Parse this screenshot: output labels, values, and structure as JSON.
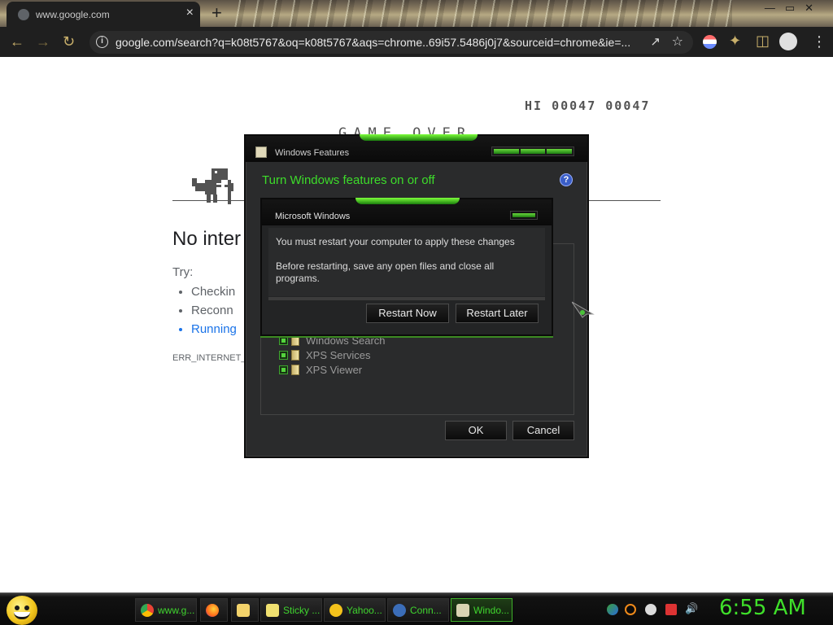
{
  "browser": {
    "tab_title": "www.google.com",
    "tab_close": "×",
    "new_tab": "+",
    "window_controls": "—▭✕",
    "url": "google.com/search?q=k08t5767&oq=k08t5767&aqs=chrome..69i57.5486j0j7&sourceid=chrome&ie=..."
  },
  "page": {
    "hi_score": "HI 00047 00047",
    "game_over": "GAME OVER",
    "heading": "No inter",
    "try_label": "Try:",
    "suggestions": [
      "Checkin",
      "Reconn",
      "Running"
    ],
    "error_code": "ERR_INTERNET_D"
  },
  "windows_features": {
    "title": "Windows Features",
    "heading": "Turn Windows features on or off",
    "help": "?",
    "features": [
      "Windows Search",
      "XPS Services",
      "XPS Viewer"
    ],
    "ok": "OK",
    "cancel": "Cancel"
  },
  "message_box": {
    "title": "Microsoft Windows",
    "message": "You must restart your computer to apply these changes",
    "detail": "Before restarting, save any open files and close all programs.",
    "restart_now": "Restart Now",
    "restart_later": "Restart Later"
  },
  "taskbar": {
    "items": [
      {
        "label": "www.g...",
        "icon_color": "#e8c33a"
      },
      {
        "label": "",
        "icon_color": "#ff6b1a"
      },
      {
        "label": "",
        "icon_color": "#f3d36b"
      },
      {
        "label": "Sticky ...",
        "icon_color": "#f0e070"
      },
      {
        "label": "Yahoo...",
        "icon_color": "#f4c21b"
      },
      {
        "label": "Conn...",
        "icon_color": "#3b6db8"
      },
      {
        "label": "Windo...",
        "icon_color": "#d8d3b3"
      }
    ],
    "clock": "6:55 AM"
  },
  "colors": {
    "accent_green": "#3ddc2a",
    "chrome_dark": "#1f1f1f",
    "link_blue": "#1a73e8"
  }
}
